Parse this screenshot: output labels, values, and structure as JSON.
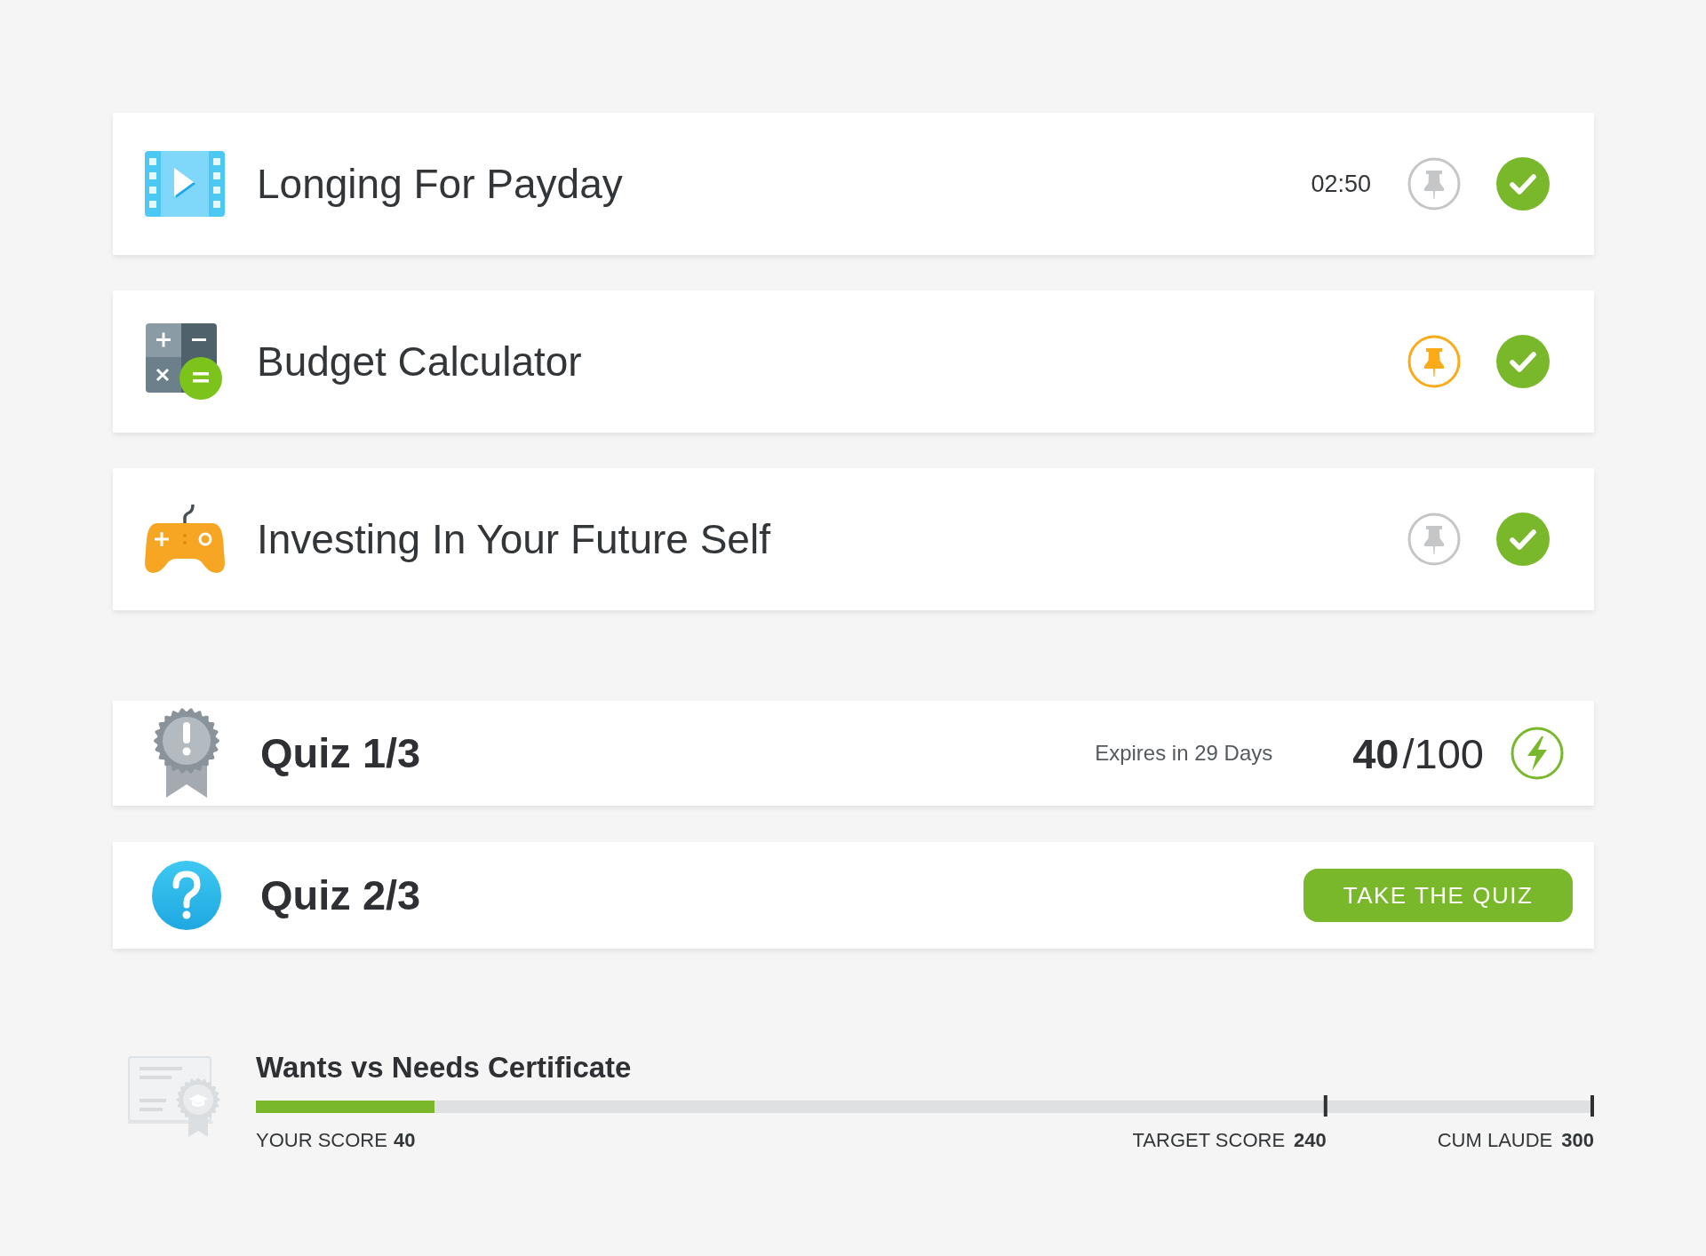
{
  "lessons": [
    {
      "kind": "video",
      "title": "Longing For Payday",
      "duration": "02:50",
      "pinned": false,
      "completed": true
    },
    {
      "kind": "calculator",
      "title": "Budget Calculator",
      "pinned": true,
      "completed": true
    },
    {
      "kind": "game",
      "title": "Investing In Your Future Self",
      "pinned": false,
      "completed": true
    }
  ],
  "quizzes": [
    {
      "kind": "result",
      "title": "Quiz 1/3",
      "expires": "Expires in 29 Days",
      "score": "40",
      "total": "/100"
    },
    {
      "kind": "pending",
      "title": "Quiz 2/3",
      "button": "TAKE THE QUIZ"
    }
  ],
  "certificate": {
    "title": "Wants vs Needs Certificate",
    "progress": {
      "level": 0.1333
    },
    "your_score": {
      "label": "YOUR SCORE",
      "value": "40"
    },
    "markers": [
      {
        "label": "TARGET SCORE",
        "value": "240",
        "level": 0.8
      },
      {
        "label": "CUM LAUDE",
        "value": "300",
        "level": 1
      }
    ]
  }
}
